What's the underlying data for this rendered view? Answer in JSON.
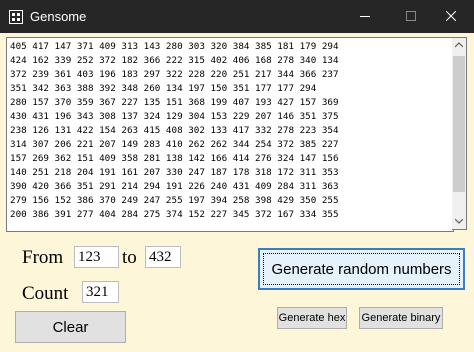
{
  "window": {
    "title": "Gensome"
  },
  "numbers": [
    "405 417 147 371 409 313 143 280 303 320 384 385 181 179 294",
    "424 162 339 252 372 182 366 222 315 402 406 168 278 340 134",
    "372 239 361 403 196 183 297 322 228 220 251 217 344 366 237",
    "351 342 363 388 392 348 260 134 197 150 351 177 177 294",
    "280 157 370 359 367 227 135 151 368 199 407 193 427 157 369",
    "430 431 196 343 308 137 324 129 304 153 229 207 146 351 375",
    "238 126 131 422 154 263 415 408 302 133 417 332 278 223 354",
    "314 307 206 221 207 149 283 410 262 262 344 254 372 385 227",
    "157 269 362 151 409 358 281 138 142 166 414 276 324 147 156",
    "140 251 218 204 191 161 207 330 247 187 178 318 172 311 353",
    "390 420 366 351 291 214 294 191 226 240 431 409 284 311 363",
    "279 156 152 386 370 249 247 255 197 394 258 398 429 350 255",
    "200 386 391 277 404 284 275 374 152 227 345 372 167 334 355"
  ],
  "labels": {
    "from": "From",
    "to": "to",
    "count": "Count"
  },
  "inputs": {
    "from_value": "123",
    "to_value": "432",
    "count_value": "321"
  },
  "buttons": {
    "generate": "Generate random numbers",
    "clear": "Clear",
    "hex": "Generate hex",
    "binary": "Generate binary"
  }
}
